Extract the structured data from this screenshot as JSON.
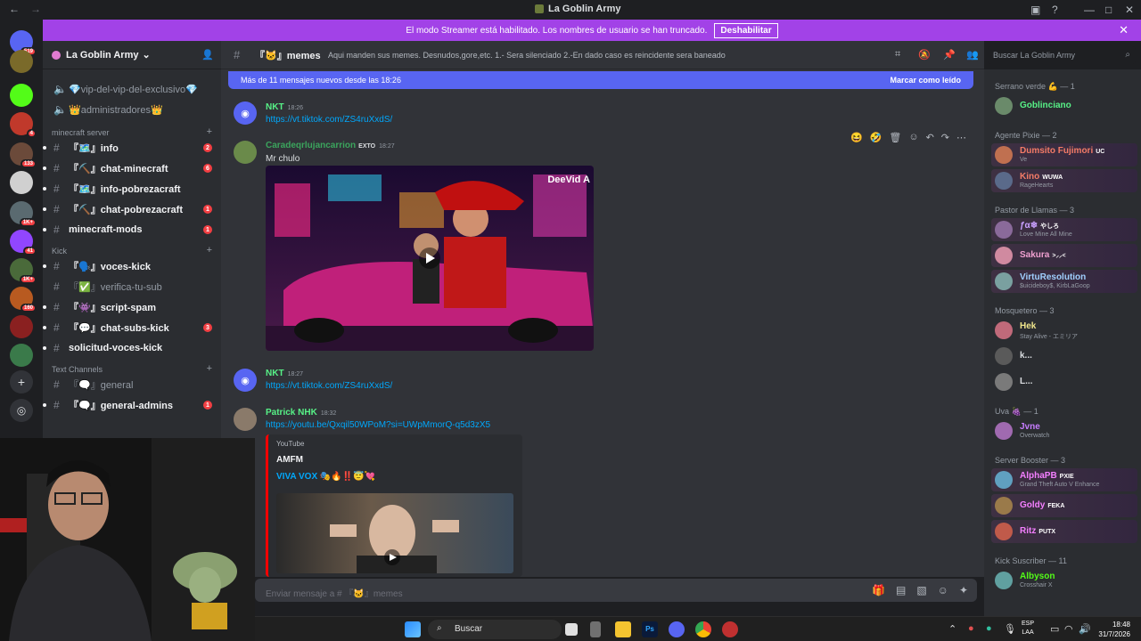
{
  "window": {
    "title": "La Goblin Army"
  },
  "banner": {
    "text": "El modo Streamer está habilitado. Los nombres de usuario se han truncado.",
    "button": "Deshabilitar"
  },
  "guilds": [
    {
      "badge": "519",
      "color": "#5865f2"
    },
    {
      "badge": "",
      "color": "#7a6a2a"
    },
    {
      "badge": "",
      "color": "#53fc18"
    },
    {
      "badge": "4",
      "color": "#c0392b"
    },
    {
      "badge": "133",
      "color": "#6b4a3a"
    },
    {
      "badge": "",
      "color": "#d0d0d0"
    },
    {
      "badge": "1K+",
      "color": "#5a6a70"
    },
    {
      "badge": "41",
      "color": "#9146ff"
    },
    {
      "badge": "1K+",
      "color": "#4a6a3a"
    },
    {
      "badge": "160",
      "color": "#b85a20"
    },
    {
      "badge": "",
      "color": "#8a2020"
    },
    {
      "badge": "",
      "color": "#3a7a4a"
    }
  ],
  "sidebar": {
    "server_name": "La Goblin Army",
    "top_channels": [
      {
        "name": "💎vip-del-vip-del-exclusivo💎"
      },
      {
        "name": "👑administradores👑"
      }
    ],
    "categories": [
      {
        "label": "minecraft server",
        "channels": [
          {
            "name": "『🗺️』info",
            "unread": true,
            "count": "2"
          },
          {
            "name": "『⛏️』chat-minecraft",
            "unread": true,
            "count": "6"
          },
          {
            "name": "『🗺️』info-pobrezacraft",
            "unread": true,
            "count": ""
          },
          {
            "name": "『⛏️』chat-pobrezacraft",
            "unread": true,
            "count": "1"
          },
          {
            "name": "minecraft-mods",
            "unread": true,
            "count": "1"
          }
        ]
      },
      {
        "label": "Kick",
        "channels": [
          {
            "name": "『🗣️』voces-kick",
            "unread": true,
            "count": ""
          },
          {
            "name": "『✅』verifica-tu-sub",
            "unread": false,
            "count": ""
          },
          {
            "name": "『👾』script-spam",
            "unread": true,
            "count": ""
          },
          {
            "name": "『💬』chat-subs-kick",
            "unread": true,
            "count": "3"
          },
          {
            "name": "solicitud-voces-kick",
            "unread": true,
            "count": ""
          }
        ]
      },
      {
        "label": "Text Channels",
        "channels": [
          {
            "name": "『🗨️』general",
            "unread": false,
            "count": ""
          },
          {
            "name": "『🗨️』general-admins",
            "unread": true,
            "count": "1"
          }
        ]
      }
    ]
  },
  "channel": {
    "name": "『🐱』memes",
    "topic": "Aqui manden sus memes. Desnudos,gore,etc. 1.- Sera silenciado 2.-En dado caso es reincidente sera baneado"
  },
  "search": {
    "placeholder": "Buscar La Goblin Army"
  },
  "new_messages": {
    "text": "Más de 11 mensajes nuevos desde las 18:26",
    "mark": "Marcar como leído"
  },
  "messages": [
    {
      "author": "NKT",
      "color": "#57f287",
      "time": "18:26",
      "link": "https://vt.tiktok.com/ZS4ruXxdS/"
    },
    {
      "author": "Caradeqrlujancarrion",
      "color": "#3ba55d",
      "tag": "EXTO",
      "time": "18:27",
      "text": "Mr chulo",
      "watermark": "DeeVid A"
    },
    {
      "author": "NKT",
      "color": "#57f287",
      "time": "18:27",
      "link": "https://vt.tiktok.com/ZS4ruXxdS/"
    },
    {
      "author": "Patrick NHK",
      "color": "#57f287",
      "time": "18:32",
      "link": "https://youtu.be/Qxqil50WPoM?si=UWpMmorQ-q5d3zX5"
    }
  ],
  "embed": {
    "provider": "YouTube",
    "author": "AMFM",
    "title": "VIVA VOX 🎭🔥‼️😇💘"
  },
  "composer": {
    "placeholder": "Enviar mensaje a # 『🐱』memes"
  },
  "members": {
    "groups": [
      {
        "label": "Serrano verde 💪 — 1",
        "members": [
          {
            "name": "Goblinciano",
            "status": "",
            "color": "#57f287"
          }
        ]
      },
      {
        "label": "Agente Pixie — 2",
        "members": [
          {
            "name": "Dumsito Fujimori",
            "status": "Ve",
            "color": "#f47b67",
            "pill": "UC"
          },
          {
            "name": "Kino",
            "status": "RageHearts",
            "color": "#f47b67",
            "pill": "WUWA"
          }
        ]
      },
      {
        "label": "Pastor de Llamas — 3",
        "members": [
          {
            "name": "ƒα❄",
            "status": "Love Mine All Mine",
            "color": "#c9a0ff",
            "pill": "やしろ"
          },
          {
            "name": "Sakura",
            "status": "",
            "color": "#f0a0d0",
            "pill": ">⸝⸝<"
          },
          {
            "name": "VirtuResolution",
            "status": "$uicideboy$, KirbLaGoop",
            "color": "#a0d0ff"
          }
        ]
      },
      {
        "label": "Mosquetero — 3",
        "members": [
          {
            "name": "Hek",
            "status": "Stay Alive - エミリア",
            "color": "#f0e68c"
          },
          {
            "name": "k...",
            "status": "",
            "color": "#dbdee1"
          },
          {
            "name": "L...",
            "status": "",
            "color": "#dbdee1"
          }
        ]
      },
      {
        "label": "Uva 🍇 — 1",
        "members": [
          {
            "name": "Jvne",
            "status": "Overwatch",
            "color": "#c77dff"
          }
        ]
      },
      {
        "label": "Server Booster — 3",
        "members": [
          {
            "name": "AlphaPB",
            "status": "Grand Theft Auto V Enhance",
            "color": "#f47fff",
            "pill": "PXIE"
          },
          {
            "name": "Goldy",
            "status": "",
            "color": "#f47fff",
            "pill": "FEKA"
          },
          {
            "name": "Ritz",
            "status": "",
            "color": "#f47fff",
            "pill": "PUTX"
          }
        ]
      },
      {
        "label": "Kick Suscriber — 11",
        "members": [
          {
            "name": "Albyson",
            "status": "Crosshair X",
            "color": "#53fc18"
          }
        ]
      }
    ]
  },
  "taskbar": {
    "search": "Buscar",
    "lang": "ESP",
    "lang2": "LAA",
    "time": "18:48",
    "date": "31/7/2026"
  }
}
